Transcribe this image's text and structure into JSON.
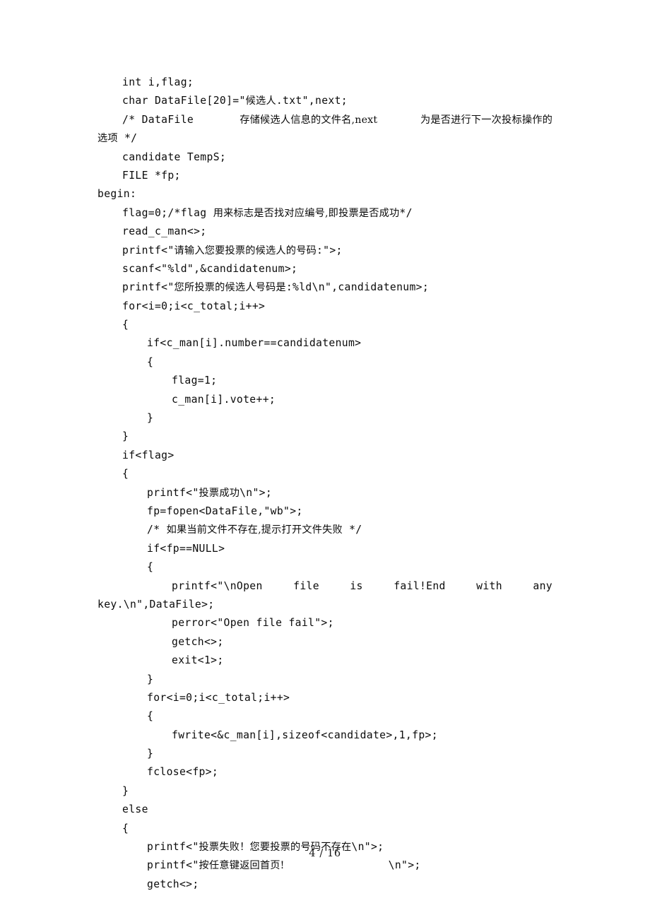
{
  "document": {
    "page_label": "4 / 16",
    "page_number": 4,
    "page_total": 16,
    "background_color": "#ffffff",
    "text_color": "#000000"
  },
  "code": {
    "language": "C",
    "note": "Parentheses in the source are rendered as angle-bracket glyphs in this scanned document.",
    "lines": [
      {
        "indent": 1,
        "text": "int i,flag;"
      },
      {
        "indent": 1,
        "text": "char DataFile[20]=\"候选人.txt\",next;"
      },
      {
        "indent": 1,
        "text": "/* DataFile 存储候选人信息的文件名,next 为是否进行下一次投标操作的",
        "justified": true,
        "segments": [
          "/* DataFile ",
          "存储候选人信息的文件名,next ",
          "为是否进行下一次投标操作的"
        ]
      },
      {
        "indent": 0,
        "text": "选项 */"
      },
      {
        "indent": 1,
        "text": "candidate TempS;"
      },
      {
        "indent": 1,
        "text": "FILE *fp;"
      },
      {
        "indent": 0,
        "text": "begin:"
      },
      {
        "indent": 1,
        "text": "flag=0;/*flag 用来标志是否找对应编号,即投票是否成功*/"
      },
      {
        "indent": 1,
        "text": "read_c_man<>;"
      },
      {
        "indent": 1,
        "text": "printf<\"请输入您要投票的候选人的号码:\">;"
      },
      {
        "indent": 1,
        "text": "scanf<\"%ld\",&candidatenum>;"
      },
      {
        "indent": 1,
        "text": "printf<\"您所投票的候选人号码是:%ld\\n\",candidatenum>;"
      },
      {
        "indent": 1,
        "text": "for<i=0;i<c_total;i++>"
      },
      {
        "indent": 1,
        "text": "{"
      },
      {
        "indent": 2,
        "text": "if<c_man[i].number==candidatenum>"
      },
      {
        "indent": 2,
        "text": "{"
      },
      {
        "indent": 3,
        "text": "flag=1;"
      },
      {
        "indent": 3,
        "text": "c_man[i].vote++;"
      },
      {
        "indent": 2,
        "text": "}"
      },
      {
        "indent": 1,
        "text": "}"
      },
      {
        "indent": 1,
        "text": "if<flag>"
      },
      {
        "indent": 1,
        "text": "{"
      },
      {
        "indent": 2,
        "text": "printf<\"投票成功\\n\">;"
      },
      {
        "indent": 2,
        "text": "fp=fopen<DataFile,\"wb\">;"
      },
      {
        "indent": 2,
        "text": "/* 如果当前文件不存在,提示打开文件失败 */"
      },
      {
        "indent": 2,
        "text": "if<fp==NULL>"
      },
      {
        "indent": 2,
        "text": "{"
      },
      {
        "indent": 3,
        "text": "printf<\"\\nOpen    file    is    fail!End    with    any",
        "justified": true,
        "segments": [
          "printf<\"\\nOpen",
          "file",
          "is",
          "fail!End",
          "with",
          "any"
        ]
      },
      {
        "indent": 0,
        "text": "key.\\n\",DataFile>;"
      },
      {
        "indent": 3,
        "text": "perror<\"Open file fail\">;"
      },
      {
        "indent": 3,
        "text": "getch<>;"
      },
      {
        "indent": 3,
        "text": "exit<1>;"
      },
      {
        "indent": 2,
        "text": "}"
      },
      {
        "indent": 2,
        "text": "for<i=0;i<c_total;i++>"
      },
      {
        "indent": 2,
        "text": "{"
      },
      {
        "indent": 3,
        "text": "fwrite<&c_man[i],sizeof<candidate>,1,fp>;"
      },
      {
        "indent": 2,
        "text": "}"
      },
      {
        "indent": 2,
        "text": "fclose<fp>;"
      },
      {
        "indent": 1,
        "text": "}"
      },
      {
        "indent": 1,
        "text": "else"
      },
      {
        "indent": 1,
        "text": "{"
      },
      {
        "indent": 2,
        "text": "printf<\"投票失败！您要投票的号码不存在\\n\">;"
      },
      {
        "indent": 2,
        "text": "printf<\"按任意键返回首页!                \\n\">;"
      },
      {
        "indent": 2,
        "text": "getch<>;"
      }
    ]
  }
}
